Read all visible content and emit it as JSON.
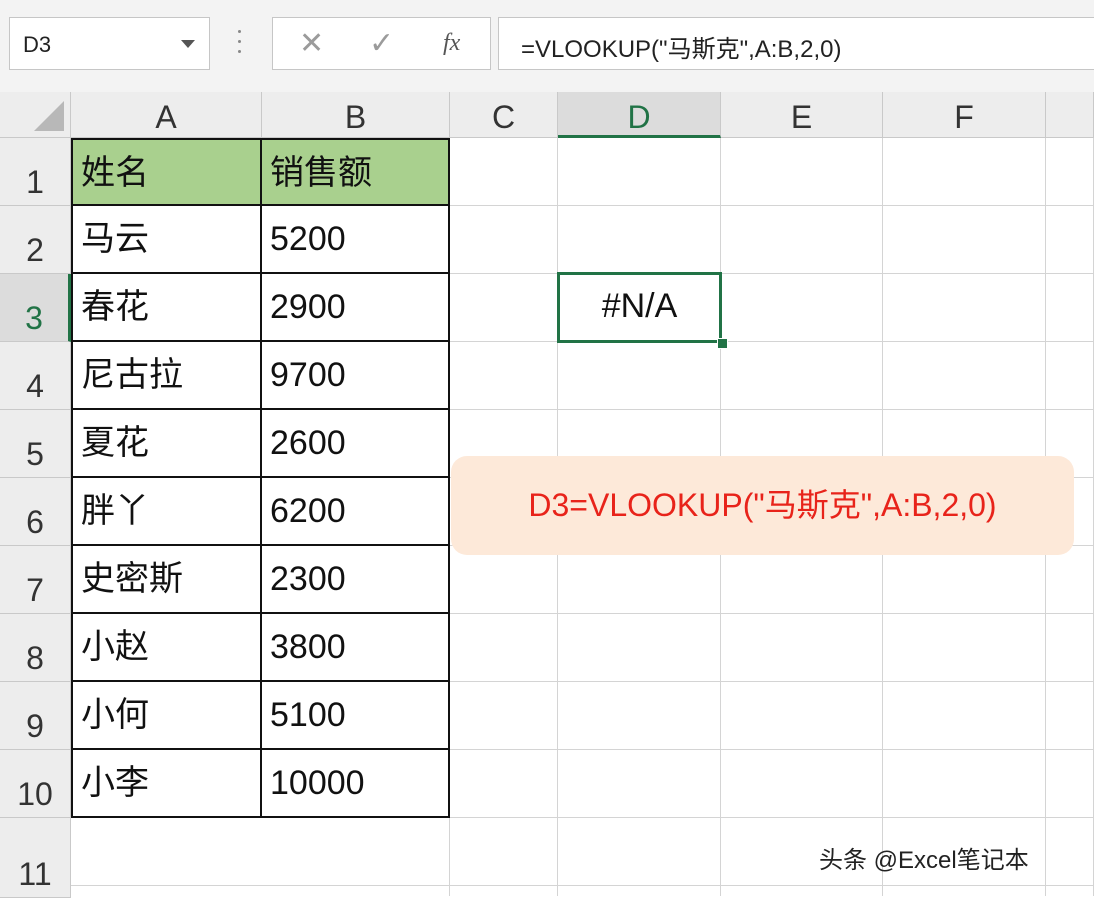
{
  "formula_bar": {
    "name_box": "D3",
    "cancel_glyph": "✕",
    "enter_glyph": "✓",
    "fx_label": "fx",
    "formula": "=VLOOKUP(\"马斯克\",A:B,2,0)"
  },
  "columns": [
    "A",
    "B",
    "C",
    "D",
    "E",
    "F"
  ],
  "active_column": "D",
  "rows": [
    "1",
    "2",
    "3",
    "4",
    "5",
    "6",
    "7",
    "8",
    "9",
    "10",
    "11"
  ],
  "active_row": "3",
  "table": {
    "header": [
      "姓名",
      "销售额"
    ],
    "rows": [
      [
        "马云",
        "5200"
      ],
      [
        "春花",
        "2900"
      ],
      [
        "尼古拉",
        "9700"
      ],
      [
        "夏花",
        "2600"
      ],
      [
        "胖丫",
        "6200"
      ],
      [
        "史密斯",
        "2300"
      ],
      [
        "小赵",
        "3800"
      ],
      [
        "小何",
        "5100"
      ],
      [
        "小李",
        "10000"
      ]
    ]
  },
  "selected_cell": {
    "ref": "D3",
    "value": "#N/A"
  },
  "annotation": {
    "text": "D3=VLOOKUP(\"马斯克\",A:B,2,0)",
    "color": "#e8231a",
    "background": "#fde9d9"
  },
  "watermark": "头条 @Excel笔记本",
  "colors": {
    "header_fill": "#a9d08e",
    "accent": "#217346"
  }
}
